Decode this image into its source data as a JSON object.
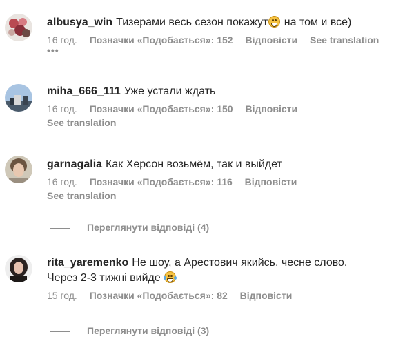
{
  "comments": [
    {
      "username": "albusya_win",
      "text_before": "Тизерами весь сезон покажут",
      "text_after": " на том и все)",
      "emoji_icon": "grinning-face-icon",
      "time": "16 год.",
      "likes": "Позначки «Подобається»: 152",
      "reply": "Відповісти",
      "translation": "See translation",
      "more": "•••"
    },
    {
      "username": "miha_666_111",
      "text": "Уже устали ждать",
      "time": "16 год.",
      "likes": "Позначки «Подобається»: 150",
      "reply": "Відповісти",
      "translation": "See translation"
    },
    {
      "username": "garnagalia",
      "text": "Как Херсон возьмём, так и выйдет",
      "time": "16 год.",
      "likes": "Позначки «Подобається»: 116",
      "reply": "Відповісти",
      "translation": "See translation",
      "view_replies": "Переглянути відповіді (4)"
    },
    {
      "username": "rita_yaremenko",
      "text_line1": "Не шоу, а Арестович якийсь, чесне слово.",
      "text_line2": "Через 2-3 тижні вийде",
      "emoji_icon": "laughing-tears-icon",
      "time": "15 год.",
      "likes": "Позначки «Подобається»: 82",
      "reply": "Відповісти",
      "view_replies": "Переглянути відповіді (3)"
    }
  ],
  "colors": {
    "text": "#262626",
    "muted": "#8e8e8e"
  }
}
